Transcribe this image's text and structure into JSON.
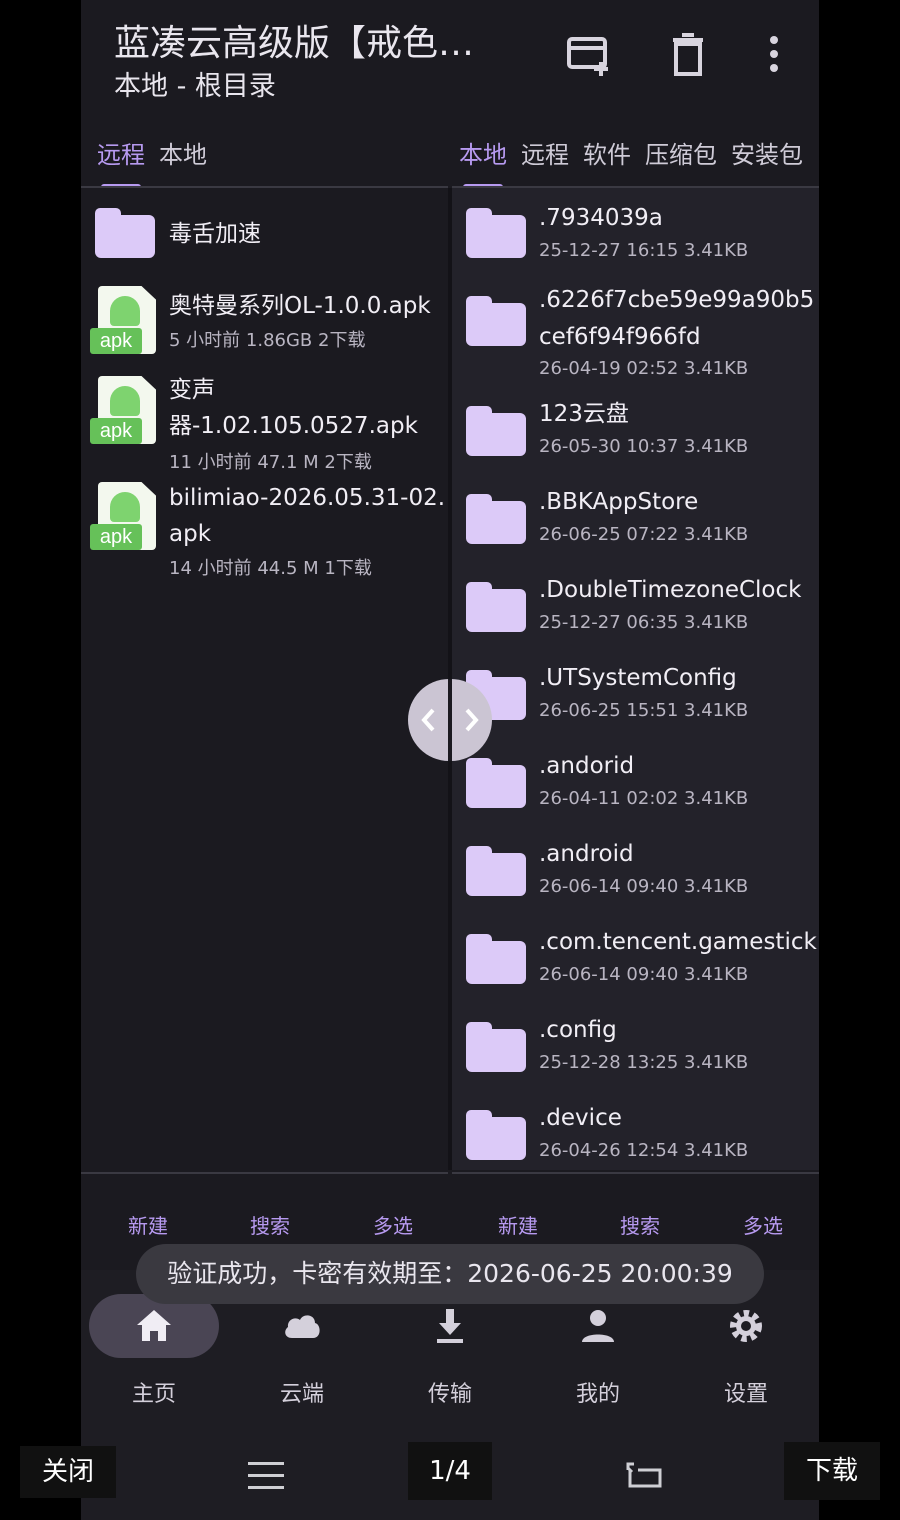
{
  "header": {
    "title": "蓝凑云高级版【戒色…",
    "subtitle": "本地 - 根目录"
  },
  "left_tabs": [
    {
      "label": "远程",
      "active": true
    },
    {
      "label": "本地",
      "active": false
    }
  ],
  "right_tabs": [
    {
      "label": "本地",
      "active": true
    },
    {
      "label": "远程",
      "active": false
    },
    {
      "label": "软件",
      "active": false
    },
    {
      "label": "压缩包",
      "active": false
    },
    {
      "label": "安装包",
      "active": false
    }
  ],
  "left_items": [
    {
      "name": "毒舌加速",
      "type": "folder"
    },
    {
      "name": "奥特曼系列OL-1.0.0.apk",
      "meta": "5 小时前 1.86GB 2下载",
      "type": "apk",
      "badge": "apk"
    },
    {
      "name_line1": "变声",
      "name_line2": "器-1.02.105.0527.apk",
      "meta": "11 小时前 47.1 M 2下载",
      "type": "apk",
      "badge": "apk"
    },
    {
      "name_line1": "bilimiao-2026.05.31-02.",
      "name_line2": "apk",
      "meta": "14 小时前 44.5 M 1下载",
      "type": "apk",
      "badge": "apk"
    }
  ],
  "right_items": [
    {
      "name": ".7934039a",
      "meta": "25-12-27 16:15 3.41KB"
    },
    {
      "name_line1": ".6226f7cbe59e99a90b5",
      "name_line2": "cef6f94f966fd",
      "meta": "26-04-19 02:52 3.41KB"
    },
    {
      "name": "123云盘",
      "meta": "26-05-30 10:37 3.41KB"
    },
    {
      "name": ".BBKAppStore",
      "meta": "26-06-25 07:22 3.41KB"
    },
    {
      "name": ".DoubleTimezoneClock",
      "meta": "25-12-27 06:35 3.41KB"
    },
    {
      "name": ".UTSystemConfig",
      "meta": "26-06-25 15:51 3.41KB"
    },
    {
      "name": ".andorid",
      "meta": "26-04-11 02:02 3.41KB"
    },
    {
      "name": ".android",
      "meta": "26-06-14 09:40 3.41KB"
    },
    {
      "name": ".com.tencent.gamestick",
      "meta": "26-06-14 09:40 3.41KB"
    },
    {
      "name": ".config",
      "meta": "25-12-28 13:25 3.41KB"
    },
    {
      "name": ".device",
      "meta": "26-04-26 12:54 3.41KB"
    }
  ],
  "actions_left": {
    "new": "新建",
    "search": "搜索",
    "multi": "多选"
  },
  "actions_right": {
    "new": "新建",
    "search": "搜索",
    "multi": "多选"
  },
  "toast": "验证成功，卡密有效期至：2026-06-25 20:00:39",
  "bottom_nav": [
    {
      "label": "主页",
      "icon": "home-icon",
      "active": true
    },
    {
      "label": "云端",
      "icon": "cloud-icon",
      "active": false
    },
    {
      "label": "传输",
      "icon": "download-icon",
      "active": false
    },
    {
      "label": "我的",
      "icon": "person-icon",
      "active": false
    },
    {
      "label": "设置",
      "icon": "gear-icon",
      "active": false
    }
  ],
  "viewer": {
    "close": "关闭",
    "page": "1/4",
    "download": "下载"
  },
  "colors": {
    "accent": "#b79af0",
    "folder": "#dccaf8",
    "background": "#1b1a20",
    "apk_green": "#66c159"
  }
}
